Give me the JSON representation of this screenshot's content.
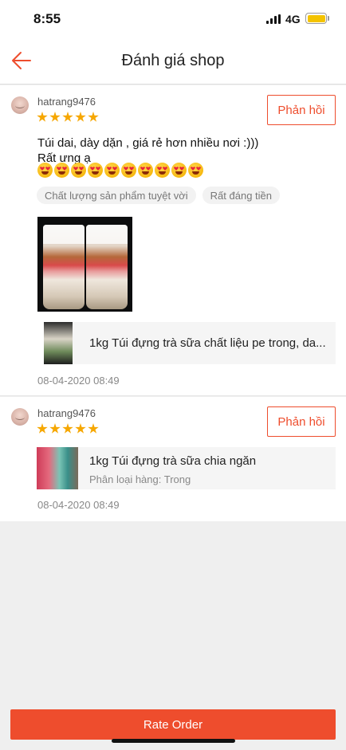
{
  "status_bar": {
    "time": "8:55",
    "network": "4G",
    "battery_color": "#f4c300"
  },
  "header": {
    "title": "Đánh giá shop",
    "back_icon": "arrow-left-icon",
    "accent_color": "#ee4d2d"
  },
  "reviews": [
    {
      "username": "hatrang9476",
      "rating": 5,
      "reply_label": "Phản hồi",
      "text_line1": "Túi dai, dày dặn , giá rẻ hơn nhiều nơi :)))",
      "text_line2": "Rất ưng ạ",
      "emoji_count": 10,
      "tags": [
        "Chất lượng sản phẩm tuyệt vời",
        "Rất đáng tiền"
      ],
      "product": {
        "title": "1kg Túi đựng trà sữa chất liệu pe trong, da..."
      },
      "timestamp": "08-04-2020 08:49"
    },
    {
      "username": "hatrang9476",
      "rating": 5,
      "reply_label": "Phản hồi",
      "product": {
        "title": "1kg Túi đựng trà sữa chia ngăn",
        "variant": "Phân loại hàng: Trong"
      },
      "timestamp": "08-04-2020 08:49"
    }
  ],
  "footer": {
    "rate_order_label": "Rate Order"
  }
}
